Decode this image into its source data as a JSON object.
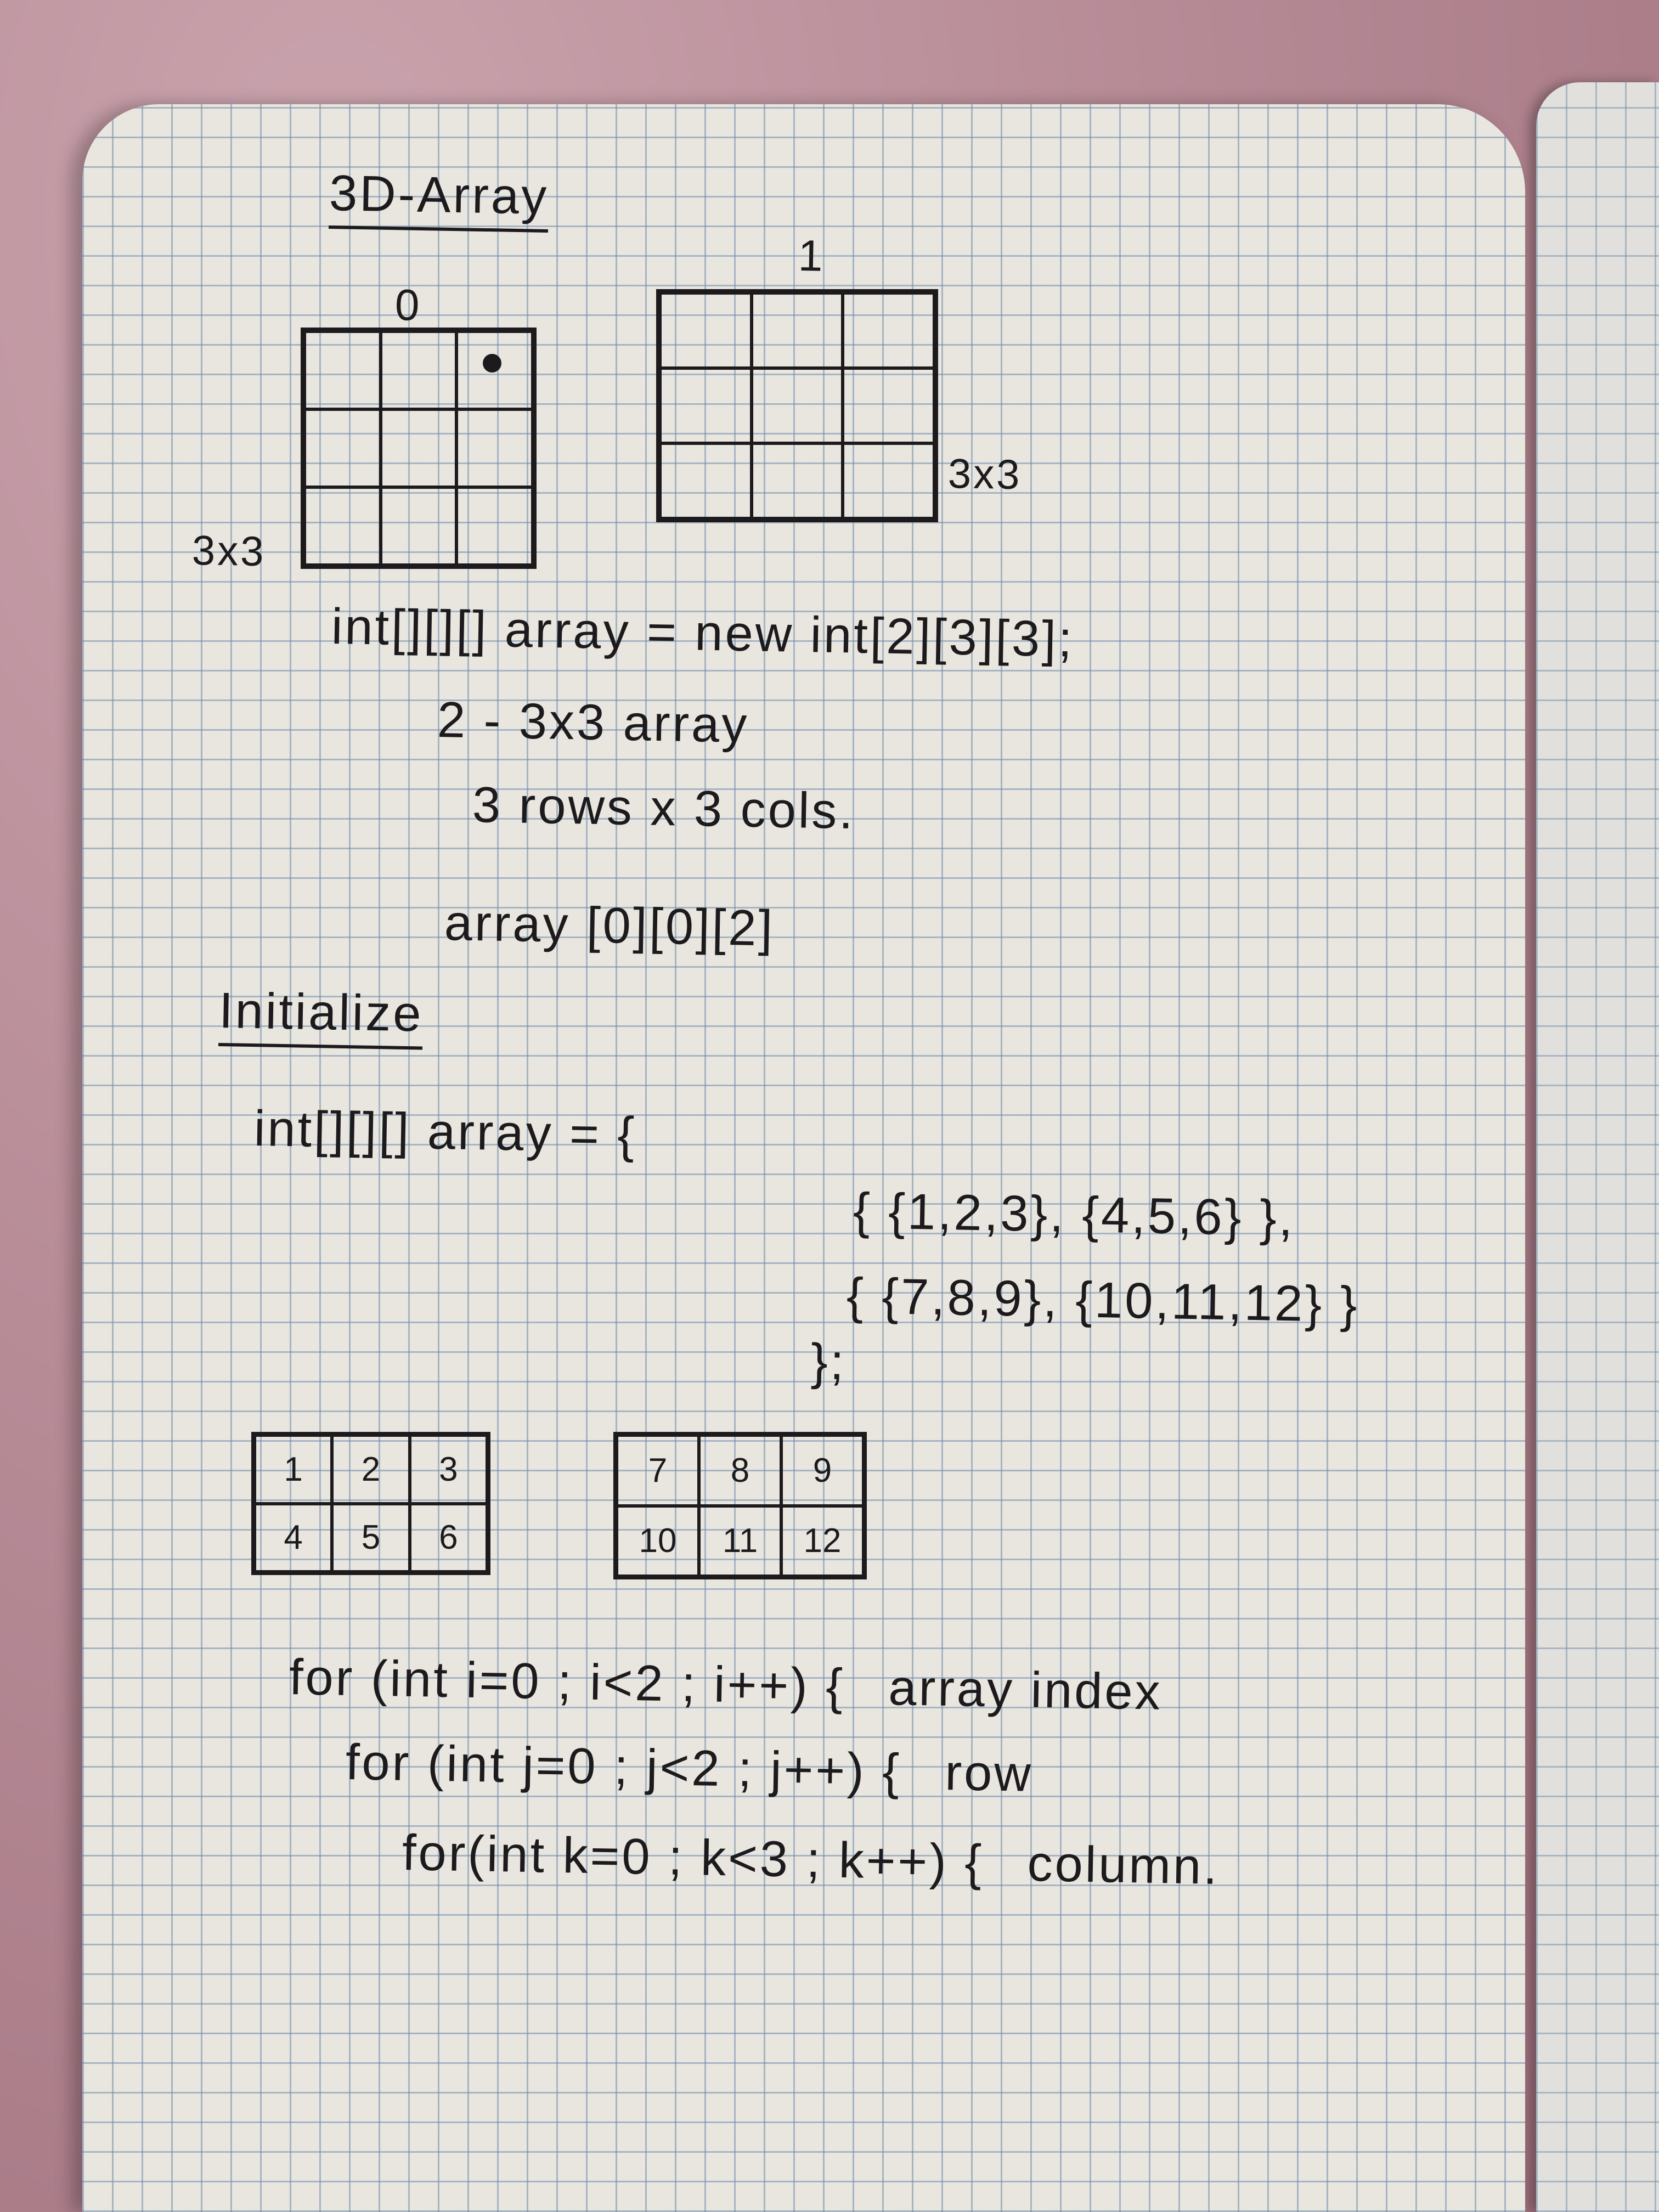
{
  "title": "3D-Array",
  "diagram": {
    "grid0_label": "0",
    "grid1_label": "1",
    "grid0_size": "3x3",
    "grid1_size": "3x3"
  },
  "lines": {
    "declaration": "int[][][] array = new int[2][3][3];",
    "explain1": "2 - 3x3 array",
    "explain2": "3 rows x 3 cols.",
    "access": "array [0][0][2]"
  },
  "initialize": {
    "heading": "Initialize",
    "line1": "int[][][] array = {",
    "line2": "{ {1,2,3}, {4,5,6} },",
    "line3": "{ {7,8,9}, {10,11,12} }",
    "line4": "};"
  },
  "tables": [
    {
      "cells": [
        "1",
        "2",
        "3",
        "4",
        "5",
        "6"
      ]
    },
    {
      "cells": [
        "7",
        "8",
        "9",
        "10",
        "11",
        "12"
      ]
    }
  ],
  "loops": [
    {
      "code": "for (int i=0 ; i<2 ; i++) {",
      "comment": "array index"
    },
    {
      "code": "for (int j=0 ; j<2 ; j++) {",
      "comment": "row"
    },
    {
      "code": "for(int k=0 ; k<3 ; k++) {",
      "comment": "column."
    }
  ]
}
